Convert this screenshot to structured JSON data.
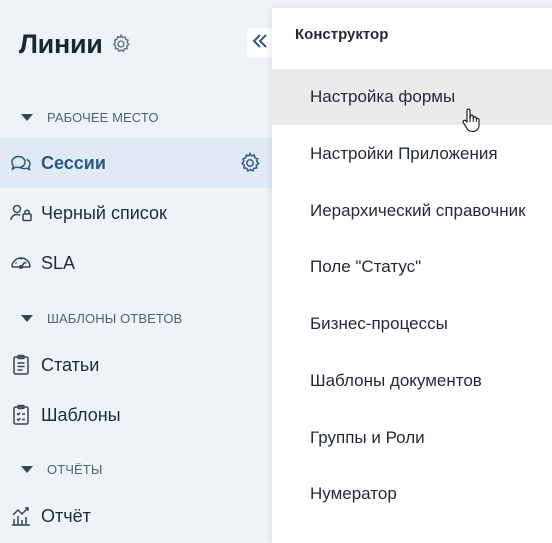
{
  "app": {
    "title": "Линии"
  },
  "sidebar": {
    "sections": [
      {
        "label": "РАБОЧЕЕ МЕСТО"
      },
      {
        "label": "ШАБЛОНЫ ОТВЕТОВ"
      },
      {
        "label": "ОТЧЁТЫ"
      }
    ],
    "items": [
      {
        "label": "Сессии",
        "icon": "chat-bubbles-icon",
        "active": true
      },
      {
        "label": "Черный список",
        "icon": "user-lock-icon"
      },
      {
        "label": "SLA",
        "icon": "speedometer-icon"
      },
      {
        "label": "Статьи",
        "icon": "clipboard-text-icon"
      },
      {
        "label": "Шаблоны",
        "icon": "clipboard-checklist-icon"
      },
      {
        "label": "Отчёт",
        "icon": "chart-icon"
      }
    ]
  },
  "dropdown": {
    "title": "Конструктор",
    "items": [
      {
        "label": "Настройка формы",
        "hovered": true
      },
      {
        "label": "Настройки Приложения"
      },
      {
        "label": "Иерархический справочник"
      },
      {
        "label": "Поле \"Статус\""
      },
      {
        "label": "Бизнес-процессы"
      },
      {
        "label": "Шаблоны документов"
      },
      {
        "label": "Группы и Роли"
      },
      {
        "label": "Нумератор"
      }
    ]
  },
  "colors": {
    "sidebar_bg": "#eef3f8",
    "active_bg": "#e0eaf4",
    "active_text": "#2b5a86",
    "hover_bg": "#ebebeb"
  }
}
